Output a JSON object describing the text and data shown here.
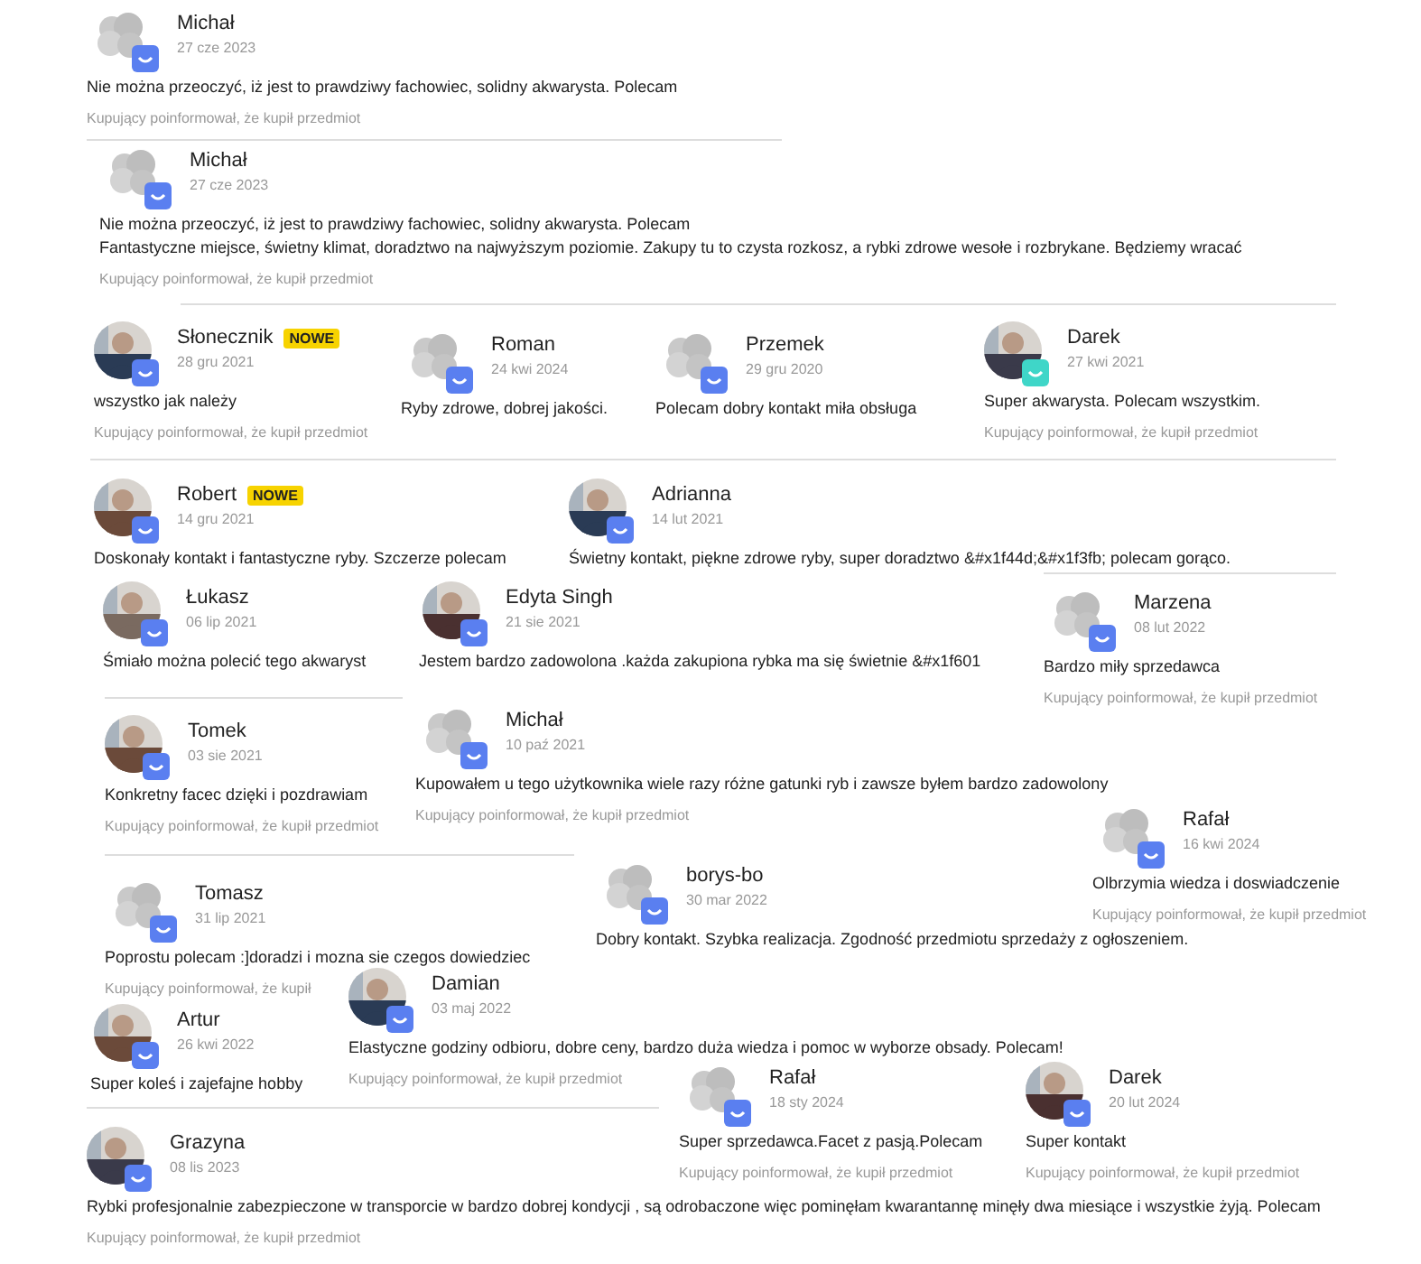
{
  "reviews": [
    {
      "name": "Michał",
      "date": "27 cze 2023",
      "kind": "placeholder",
      "color": "#5a7ff0",
      "lines": [
        "Nie można przeoczyć, iż jest to prawdziwy fachowiec, solidny akwarysta. Polecam"
      ],
      "footer": "Kupujący poinformował, że kupił przedmiot"
    },
    {
      "name": "Michał",
      "date": "27 cze 2023",
      "kind": "placeholder",
      "color": "#5a7ff0",
      "lines": [
        "Nie można przeoczyć, iż jest to prawdziwy fachowiec, solidny akwarysta. Polecam",
        "Fantastyczne miejsce, świetny klimat, doradztwo na najwyższym poziomie. Zakupy tu to czysta rozkosz, a rybki zdrowe wesołe i rozbrykane. Będziemy wracać"
      ],
      "footer": "Kupujący poinformował, że kupił przedmiot"
    },
    {
      "name": "Słonecznik",
      "tag": "NOWE",
      "date": "28 gru 2021",
      "color": "#5a7ff0",
      "lines": [
        "wszystko jak należy"
      ],
      "footer": "Kupujący poinformował, że kupił przedmiot"
    },
    {
      "name": "Roman",
      "date": "24 kwi 2024",
      "kind": "placeholder",
      "color": "#5a7ff0",
      "lines": [
        "Ryby zdrowe, dobrej jakości."
      ]
    },
    {
      "name": "Przemek",
      "date": "29 gru 2020",
      "kind": "placeholder",
      "color": "#5a7ff0",
      "lines": [
        "Polecam dobry kontakt miła obsługa"
      ]
    },
    {
      "name": "Darek",
      "date": "27 kwi 2021",
      "color": "#3fd6c8",
      "lines": [
        "Super akwarysta. Polecam wszystkim."
      ],
      "footer": "Kupujący poinformował, że kupił przedmiot"
    },
    {
      "name": "Robert",
      "tag": "NOWE",
      "date": "14 gru 2021",
      "color": "#5a7ff0",
      "lines": [
        "Doskonały kontakt i fantastyczne ryby. Szczerze polecam"
      ]
    },
    {
      "name": "Adrianna",
      "date": "14 lut 2021",
      "color": "#5a7ff0",
      "lines": [
        "Świetny kontakt, piękne zdrowe ryby, super doradztwo &#x1f44d;&#x1f3fb; polecam gorąco."
      ]
    },
    {
      "name": "Łukasz",
      "date": "06 lip 2021",
      "color": "#5a7ff0",
      "lines": [
        "Śmiało można polecić tego akwaryst"
      ]
    },
    {
      "name": "Edyta Singh",
      "date": "21 sie 2021",
      "color": "#5a7ff0",
      "lines": [
        "Jestem bardzo zadowolona .każda zakupiona rybka ma się świetnie &#x1f601"
      ]
    },
    {
      "name": "Marzena",
      "date": "08 lut 2022",
      "kind": "placeholder",
      "color": "#5a7ff0",
      "lines": [
        "Bardzo miły sprzedawca"
      ],
      "footer": "Kupujący poinformował, że kupił przedmiot"
    },
    {
      "name": "Tomek",
      "date": "03 sie 2021",
      "color": "#5a7ff0",
      "lines": [
        "Konkretny facec dzięki i pozdrawiam"
      ],
      "footer": "Kupujący poinformował, że kupił przedmiot"
    },
    {
      "name": "Michał",
      "date": "10 paź 2021",
      "kind": "placeholder",
      "color": "#5a7ff0",
      "lines": [
        "Kupowałem u tego użytkownika wiele razy różne gatunki ryb i zawsze byłem bardzo zadowolony"
      ],
      "footer": "Kupujący poinformował, że kupił przedmiot"
    },
    {
      "name": "Rafał",
      "date": "16 kwi 2024",
      "kind": "placeholder",
      "color": "#5a7ff0",
      "lines": [
        "Olbrzymia wiedza i doswiadczenie"
      ],
      "footer": "Kupujący poinformował, że kupił przedmiot"
    },
    {
      "name": "Tomasz",
      "date": "31 lip 2021",
      "kind": "placeholder",
      "color": "#5a7ff0",
      "lines": [
        "Poprostu polecam :]doradzi i mozna sie czegos dowiedziec"
      ],
      "footer": "Kupujący poinformował, że kupił"
    },
    {
      "name": "borys-bo",
      "date": "30 mar 2022",
      "kind": "placeholder",
      "color": "#5a7ff0",
      "lines": [
        "Dobry kontakt. Szybka realizacja. Zgodność przedmiotu sprzedaży z ogłoszeniem."
      ]
    },
    {
      "name": "Artur",
      "date": "26 kwi 2022",
      "color": "#5a7ff0",
      "lines": [
        "Super koleś i zajefajne hobby"
      ]
    },
    {
      "name": "Damian",
      "date": "03 maj 2022",
      "color": "#5a7ff0",
      "lines": [
        "Elastyczne godziny odbioru, dobre ceny, bardzo duża wiedza i pomoc w wyborze obsady. Polecam!"
      ],
      "footer": "Kupujący poinformował, że kupił przedmiot"
    },
    {
      "name": "Rafał",
      "date": "18 sty 2024",
      "kind": "placeholder",
      "color": "#5a7ff0",
      "lines": [
        "Super sprzedawca.Facet z pasją.Polecam"
      ],
      "footer": "Kupujący poinformował, że kupił przedmiot"
    },
    {
      "name": "Darek",
      "date": "20 lut 2024",
      "color": "#5a7ff0",
      "lines": [
        "Super kontakt"
      ],
      "footer": "Kupujący poinformował, że kupił przedmiot"
    },
    {
      "name": "Grazyna",
      "date": "08 lis 2023",
      "color": "#5a7ff0",
      "lines": [
        "Rybki profesjonalnie zabezpieczone w transporcie w bardzo dobrej kondycji , są odrobaczone więc pominęłam kwarantannę minęły dwa miesiące i wszystkie żyją. Polecam"
      ],
      "footer": "Kupujący poinformował, że kupił przedmiot"
    }
  ]
}
